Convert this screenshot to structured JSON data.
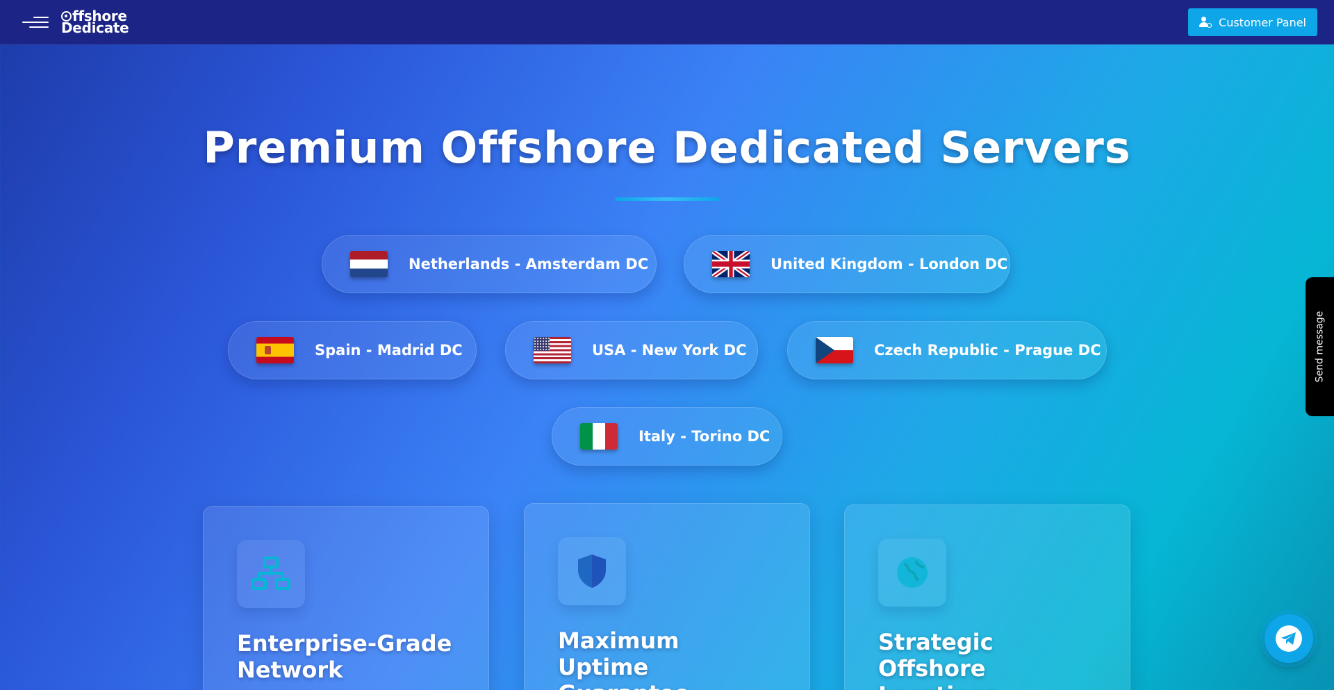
{
  "header": {
    "logo_line1": "ffshore",
    "logo_line2": "Dedicate",
    "customer_panel_label": "Customer Panel"
  },
  "hero": {
    "title": "Premium Offshore Dedicated Servers"
  },
  "locations": [
    {
      "label": "Netherlands - Amsterdam DC",
      "flag": "netherlands-flag"
    },
    {
      "label": "United Kingdom - London DC",
      "flag": "uk-flag"
    },
    {
      "label": "Spain - Madrid DC",
      "flag": "spain-flag"
    },
    {
      "label": "USA - New York DC",
      "flag": "usa-flag"
    },
    {
      "label": "Czech Republic - Prague DC",
      "flag": "czech-flag"
    },
    {
      "label": "Italy - Torino DC",
      "flag": "italy-flag"
    }
  ],
  "features": [
    {
      "title": "Enterprise-Grade Network",
      "icon": "network-icon"
    },
    {
      "title": "Maximum Uptime Guarantee",
      "icon": "shield-icon"
    },
    {
      "title": "Strategic Offshore Locations",
      "icon": "globe-icon"
    }
  ],
  "widgets": {
    "send_message_label": "Send message",
    "telegram_icon": "telegram-icon"
  },
  "colors": {
    "topbar": "#1c2585",
    "accent": "#0ea5e9",
    "icon_cyan": "#06b6d4"
  }
}
